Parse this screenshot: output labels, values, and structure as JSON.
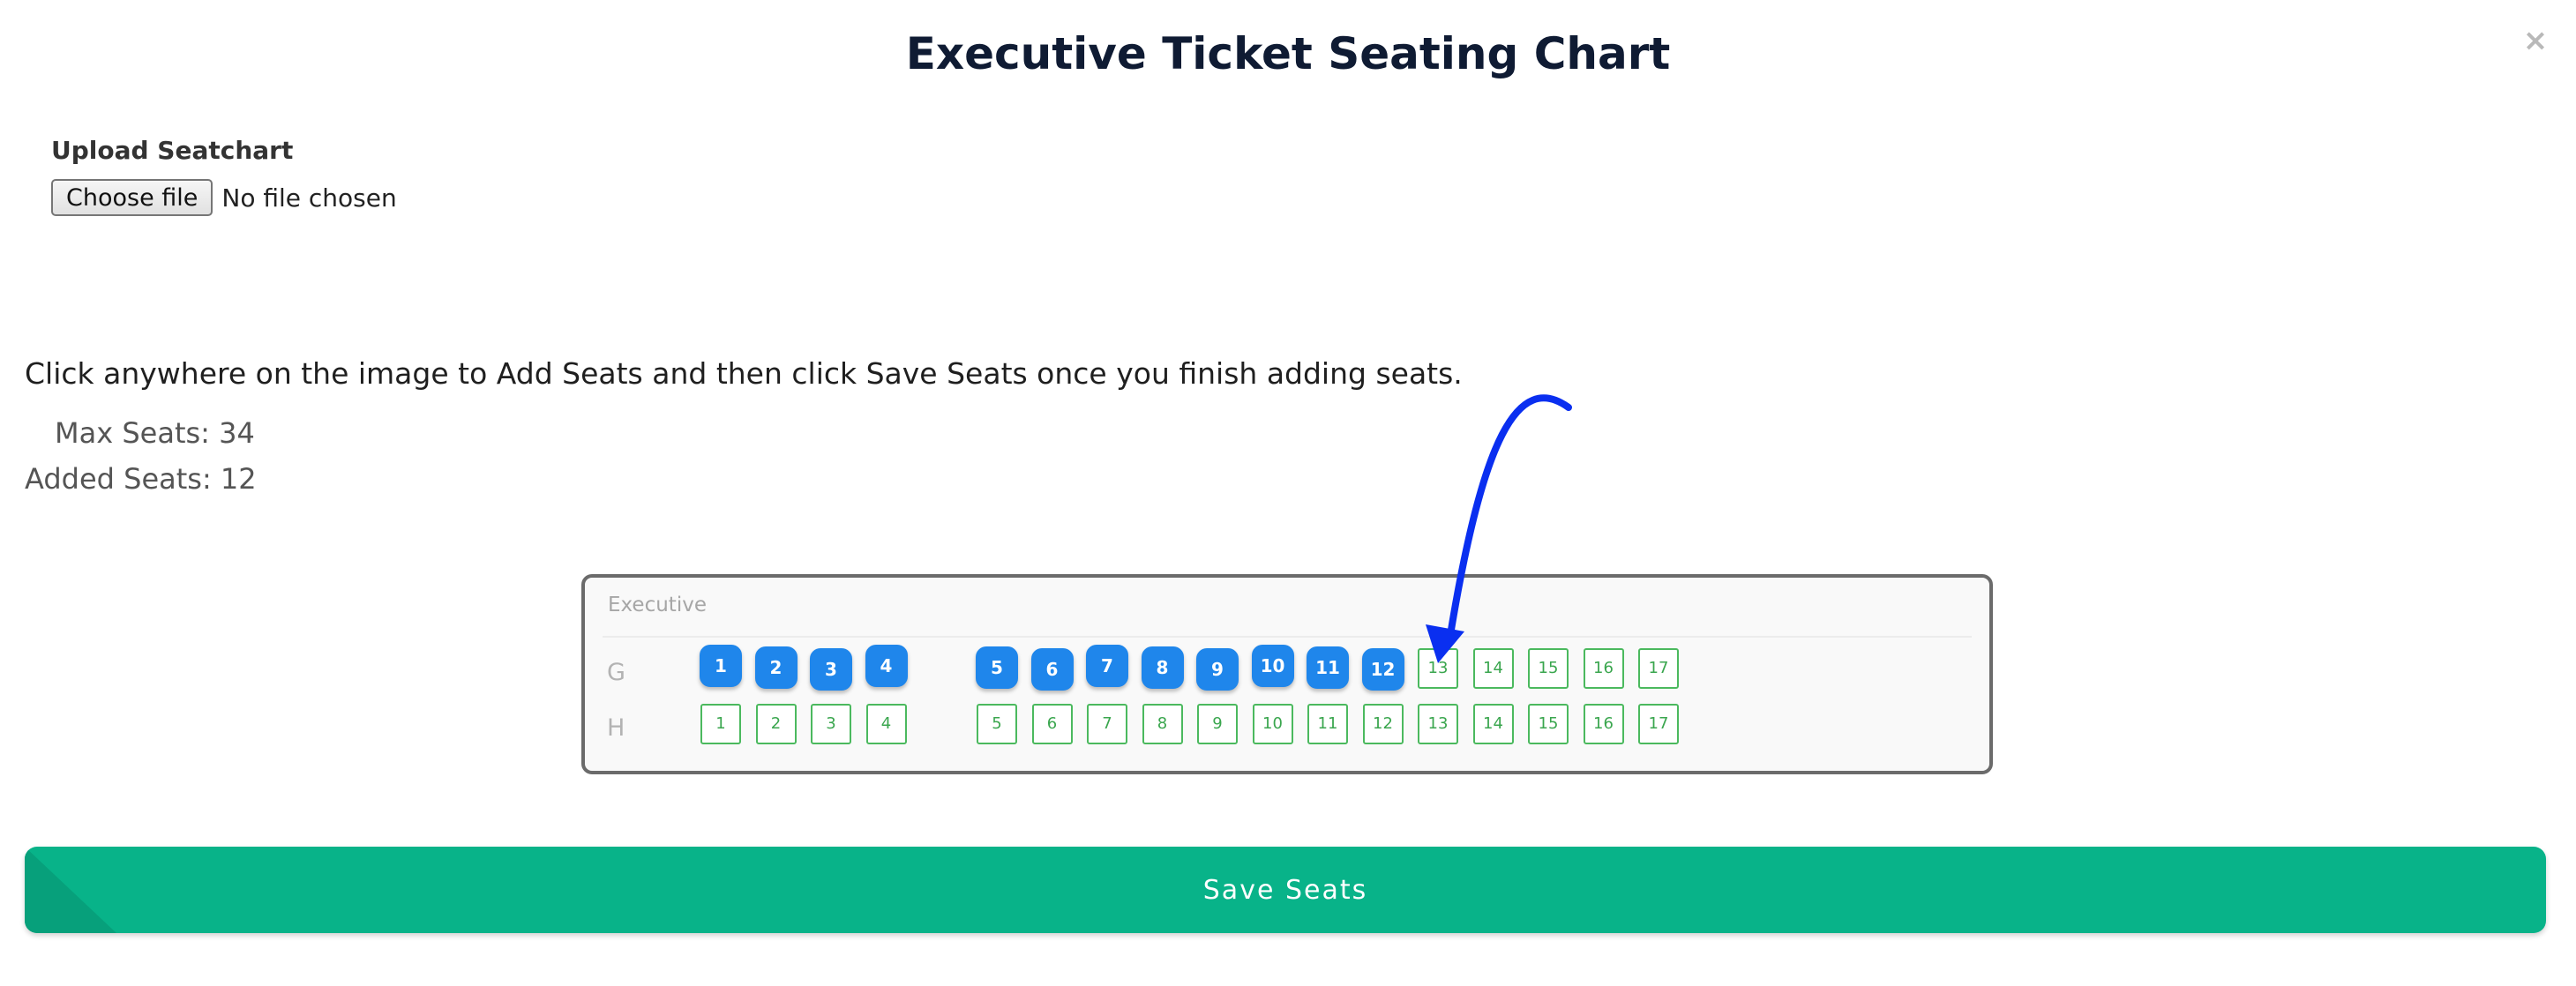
{
  "modal": {
    "title": "Executive Ticket Seating Chart",
    "close_icon": "×"
  },
  "upload": {
    "label": "Upload Seatchart",
    "button_label": "Choose file",
    "status": "No file chosen"
  },
  "instructions": "Click anywhere on the image to Add Seats and then click Save Seats once you finish adding seats.",
  "stats": {
    "max_seats": "Max Seats: 34",
    "added_seats": "Added Seats: 12"
  },
  "chart": {
    "section_name": "Executive",
    "rows": [
      {
        "label": "G",
        "seats": [
          {
            "number": "1",
            "added": true
          },
          {
            "number": "2",
            "added": true
          },
          {
            "number": "3",
            "added": true
          },
          {
            "number": "4",
            "added": true
          },
          {
            "number": "5",
            "added": true
          },
          {
            "number": "6",
            "added": true
          },
          {
            "number": "7",
            "added": true
          },
          {
            "number": "8",
            "added": true
          },
          {
            "number": "9",
            "added": true
          },
          {
            "number": "10",
            "added": true
          },
          {
            "number": "11",
            "added": true
          },
          {
            "number": "12",
            "added": true
          },
          {
            "number": "13",
            "added": false
          },
          {
            "number": "14",
            "added": false
          },
          {
            "number": "15",
            "added": false
          },
          {
            "number": "16",
            "added": false
          },
          {
            "number": "17",
            "added": false
          }
        ]
      },
      {
        "label": "H",
        "seats": [
          {
            "number": "1",
            "added": false
          },
          {
            "number": "2",
            "added": false
          },
          {
            "number": "3",
            "added": false
          },
          {
            "number": "4",
            "added": false
          },
          {
            "number": "5",
            "added": false
          },
          {
            "number": "6",
            "added": false
          },
          {
            "number": "7",
            "added": false
          },
          {
            "number": "8",
            "added": false
          },
          {
            "number": "9",
            "added": false
          },
          {
            "number": "10",
            "added": false
          },
          {
            "number": "11",
            "added": false
          },
          {
            "number": "12",
            "added": false
          },
          {
            "number": "13",
            "added": false
          },
          {
            "number": "14",
            "added": false
          },
          {
            "number": "15",
            "added": false
          },
          {
            "number": "16",
            "added": false
          },
          {
            "number": "17",
            "added": false
          }
        ]
      }
    ]
  },
  "save_button": {
    "label": "Save Seats"
  },
  "colors": {
    "seat_added": "#1f86eb",
    "seat_available_border": "#4bb95e",
    "save_button": "#08b389",
    "annotation_arrow": "#0a2ff0"
  }
}
